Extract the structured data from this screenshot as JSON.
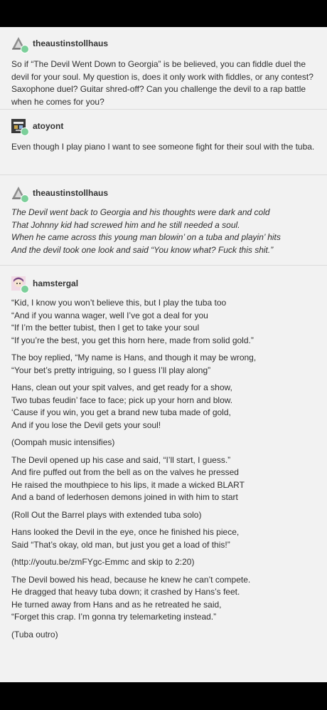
{
  "posts": [
    {
      "username": "theaustinstollhaus",
      "avatar_icon": "triangle-logo",
      "text": "So if “The Devil Went Down to Georgia” is be believed, you can fiddle duel the devil for your soul. My question is, does it only work with fiddles, or any contest? Saxophone duel? Guitar shred-off? Can you challenge the devil to a rap battle when he comes for you?"
    },
    {
      "username": "atoyont",
      "avatar_icon": "pixel-avatar",
      "text": "Even though I play piano I want to see someone fight for their soul with the tuba."
    },
    {
      "username": "theaustinstollhaus",
      "avatar_icon": "triangle-logo",
      "lines": [
        "The Devil went back to Georgia and his thoughts were dark and cold",
        "That Johnny kid had screwed him and he still needed a soul.",
        "When he came across this young man blowin’ on a tuba and playin’ hits",
        "And the devil took one look and said “You know what? Fuck this shit.”"
      ]
    },
    {
      "username": "hamstergal",
      "avatar_icon": "anime-avatar",
      "stanzas": [
        [
          "“Kid, I know you won’t believe this, but I play the tuba too",
          "“And if you wanna wager, well I’ve got a deal for you",
          "“If I’m the better tubist, then I get to take your soul",
          "“If you’re the best, you get this horn here, made from solid gold.”"
        ],
        [
          "The boy replied, “My name is Hans, and though it may be wrong,",
          "“Your bet’s pretty intriguing, so I guess I’ll play along”"
        ],
        [
          "Hans, clean out your spit valves, and get ready for a show,",
          "Two tubas feudin’ face to face; pick up your horn and blow.",
          "‘Cause if you win, you get a brand new tuba made of gold,",
          "And if you lose the Devil gets your soul!"
        ],
        [
          "(Oompah music intensifies)"
        ],
        [
          "The Devil opened up his case and said, “I’ll start, I guess.”",
          "And fire puffed out from the bell as on the valves he pressed",
          "He raised the mouthpiece to his lips, it made a wicked BLART",
          "And a band of lederhosen demons joined in with him to start"
        ],
        [
          "(Roll Out the Barrel plays with extended tuba solo)"
        ],
        [
          "Hans looked the Devil in the eye, once he finished his piece,",
          "Said “That’s okay, old man, but just you get a load of this!”"
        ],
        [
          "(http://youtu.be/zmFYgc-Emmc and skip to 2:20)"
        ],
        [
          "The Devil bowed his head, because he knew he can’t compete.",
          "He dragged that heavy tuba down; it crashed by Hans’s feet.",
          "He turned away from Hans and as he retreated he said,",
          "“Forget this crap. I’m gonna try telemarketing instead.”"
        ],
        [
          "(Tuba outro)"
        ]
      ]
    }
  ]
}
